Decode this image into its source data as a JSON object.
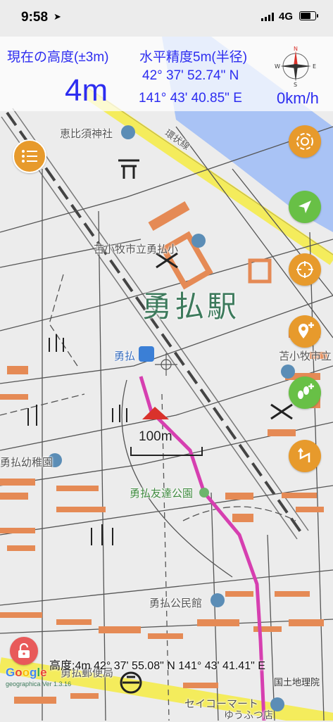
{
  "status_bar": {
    "time": "9:58",
    "network": "4G"
  },
  "hud": {
    "altitude_label": "現在の高度(±3m)",
    "accuracy_label": "水平精度5m(半径)",
    "altitude_value": "4m",
    "latitude": "42° 37' 52.74\" N",
    "longitude": "141° 43' 40.85\" E",
    "speed": "0km/h",
    "compass_letters": {
      "n": "N",
      "e": "E",
      "s": "S",
      "w": "W"
    }
  },
  "map": {
    "labels": {
      "shrine": "恵比須神社",
      "railway": "環状線",
      "school": "苫小牧市立勇払小",
      "station_name": "勇払駅",
      "station_small": "勇払",
      "city_right": "苫小牧市立",
      "kindergarten": "勇払幼稚園",
      "park": "勇払友達公園",
      "community_hall": "勇払公民館",
      "post_office": "勇払郵便局",
      "store": "セイコーマート",
      "store_sub": "ゆうふつ店"
    },
    "scale_label": "100m",
    "footer_info": "高度:4m 42° 37' 55.08\" N 141° 43' 41.41\" E",
    "attribution": "国土地理院",
    "google": "Google",
    "app_version": "geographica Ver 1.3.16"
  },
  "colors": {
    "hud_text": "#2d2df0",
    "orange_button": "#e79a2c",
    "green_button": "#68c046",
    "track_line": "#d63fb0",
    "road_yellow": "#f4ec5c",
    "river_blue": "#a9c3f5",
    "building_orange": "#e58a55",
    "station_green": "#3d7a5c"
  },
  "buttons": {
    "menu": "list-icon",
    "layers": "swirl-icon",
    "locate": "navigation-arrow-icon",
    "target": "crosshair-target-icon",
    "add_point": "map-pin-plus-icon",
    "record_track": "footsteps-plus-icon",
    "route": "route-icon",
    "lock": "lock-icon"
  }
}
